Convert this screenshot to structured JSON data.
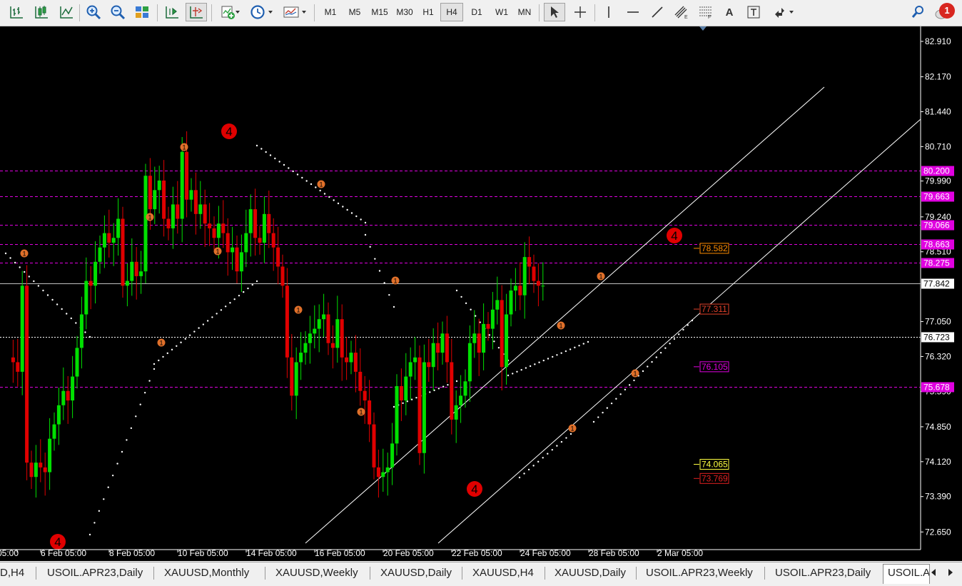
{
  "toolbar": {
    "timeframes": [
      "M1",
      "M5",
      "M15",
      "M30",
      "H1",
      "H4",
      "D1",
      "W1",
      "MN"
    ],
    "active_timeframe": "H4",
    "text_tool_label": "A",
    "notifications_count": "1"
  },
  "chart": {
    "symbol": "USOIL.APR23",
    "timeframe": "H4",
    "price_scale": [
      "82.910",
      "82.170",
      "81.440",
      "80.710",
      "79.990",
      "79.240",
      "78.510",
      "77.050",
      "76.320",
      "75.590",
      "74.850",
      "74.120",
      "73.390",
      "72.650"
    ],
    "time_scale": [
      "05:00",
      "6 Feb 05:00",
      "8 Feb 05:00",
      "10 Feb 05:00",
      "14 Feb 05:00",
      "16 Feb 05:00",
      "20 Feb 05:00",
      "22 Feb 05:00",
      "24 Feb 05:00",
      "28 Feb 05:00",
      "2 Mar 05:00"
    ],
    "current_price": "77.842",
    "h_levels": [
      {
        "price": "80.200",
        "color": "#e000e0",
        "style": "dash"
      },
      {
        "price": "79.663",
        "color": "#e000e0",
        "style": "dash"
      },
      {
        "price": "79.066",
        "color": "#e000e0",
        "style": "dash"
      },
      {
        "price": "78.663",
        "color": "#e000e0",
        "style": "dash"
      },
      {
        "price": "78.275",
        "color": "#e000e0",
        "style": "dash"
      },
      {
        "price": "76.723",
        "color": "#ffffff",
        "style": "dot"
      },
      {
        "price": "75.678",
        "color": "#e000e0",
        "style": "dash"
      }
    ],
    "right_labels": [
      {
        "text": "78.582",
        "color": "#ff8c00"
      },
      {
        "text": "77.311",
        "color": "#e0402a"
      },
      {
        "text": "76.105",
        "color": "#e000e0"
      },
      {
        "text": "74.065",
        "color": "#ffff40"
      },
      {
        "text": "73.769",
        "color": "#e02020"
      }
    ],
    "wave_labels_major": [
      "4",
      "4",
      "4",
      "4"
    ],
    "wave_labels_minor": [
      "1",
      "1",
      "1",
      "1",
      "1",
      "1",
      "1",
      "1",
      "1",
      "1",
      "1",
      "1",
      "1"
    ],
    "colors": {
      "bull": "#00e000",
      "bear": "#e00000",
      "background": "#000000",
      "grid_text": "#ffffff"
    }
  },
  "tabs": {
    "items": [
      "D,H4",
      "USOIL.APR23,Daily",
      "XAUUSD,Monthly",
      "XAUUSD,Weekly",
      "XAUUSD,Daily",
      "XAUUSD,H4",
      "XAUUSD,Daily",
      "USOIL.APR23,Weekly",
      "USOIL.APR23,Daily",
      "USOIL.A"
    ],
    "active_index": 9
  }
}
